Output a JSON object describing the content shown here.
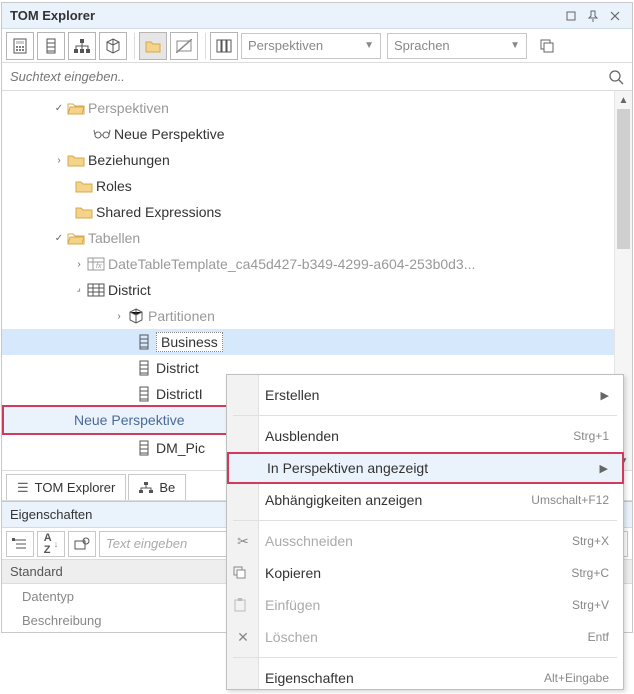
{
  "title": "TOM Explorer",
  "toolbar_combos": {
    "perspectives": "Perspektiven",
    "languages": "Sprachen"
  },
  "search": {
    "placeholder": "Suchtext eingeben.."
  },
  "tree": {
    "perspectives_label": "Perspektiven",
    "new_perspective_label": "Neue Perspektive",
    "relations_label": "Beziehungen",
    "roles_label": "Roles",
    "shared_label": "Shared Expressions",
    "tables_label": "Tabellen",
    "date_table_label": "DateTableTemplate_ca45d427-b349-4299-a604-253b0d3...",
    "district_label": "District",
    "partitions_label": "Partitionen",
    "business_label": "Business",
    "district_col_label": "District",
    "districtI_label": "DistrictI",
    "dm_pic_label": "DM_Pic"
  },
  "popout": {
    "label": "Neue Perspektive"
  },
  "context": {
    "create": "Erstellen",
    "hide": "Ausblenden",
    "hide_sc": "Strg+1",
    "in_persp": "In Perspektiven angezeigt",
    "deps": "Abhängigkeiten anzeigen",
    "deps_sc": "Umschalt+F12",
    "cut": "Ausschneiden",
    "cut_sc": "Strg+X",
    "copy": "Kopieren",
    "copy_sc": "Strg+C",
    "paste": "Einfügen",
    "paste_sc": "Strg+V",
    "delete": "Löschen",
    "delete_sc": "Entf",
    "props": "Eigenschaften",
    "props_sc": "Alt+Eingabe"
  },
  "tabs": {
    "explorer": "TOM Explorer",
    "be": "Be"
  },
  "properties": {
    "title": "Eigenschaften",
    "filter_placeholder": "Text eingeben",
    "group": "Standard",
    "row1": "Datentyp",
    "row2": "Beschreibung"
  }
}
